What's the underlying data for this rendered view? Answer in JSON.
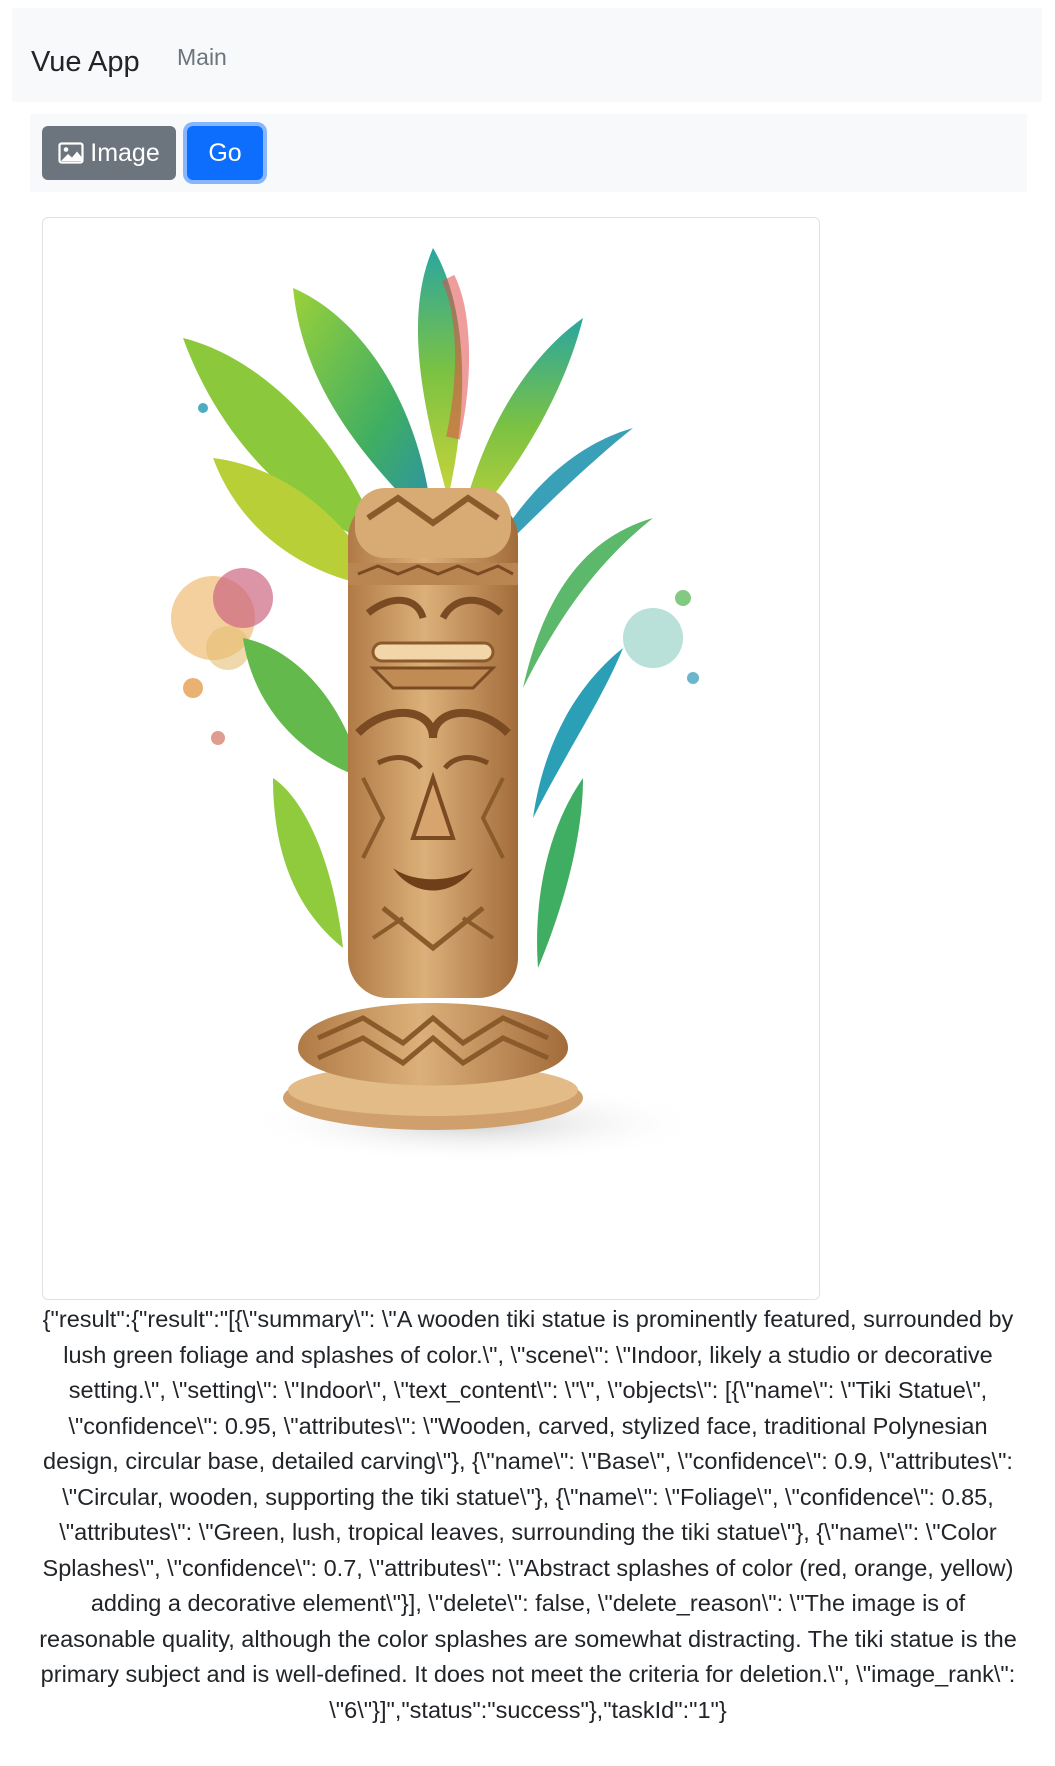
{
  "navbar": {
    "brand": "Vue App",
    "links": [
      {
        "label": "Main"
      }
    ]
  },
  "toolbar": {
    "image_button_label": "Image",
    "image_button_icon": "image-icon",
    "go_button_label": "Go"
  },
  "image": {
    "subject": "watercolor-illustration"
  },
  "result_text": "{\"result\":{\"result\":\"[{\\\"summary\\\": \\\"A wooden tiki statue is prominently featured, surrounded by lush green foliage and splashes of color.\\\", \\\"scene\\\": \\\"Indoor, likely a studio or decorative setting.\\\", \\\"setting\\\": \\\"Indoor\\\", \\\"text_content\\\": \\\"\\\", \\\"objects\\\": [{\\\"name\\\": \\\"Tiki Statue\\\", \\\"confidence\\\": 0.95, \\\"attributes\\\": \\\"Wooden, carved, stylized face, traditional Polynesian design, circular base, detailed carving\\\"}, {\\\"name\\\": \\\"Base\\\", \\\"confidence\\\": 0.9, \\\"attributes\\\": \\\"Circular, wooden, supporting the tiki statue\\\"}, {\\\"name\\\": \\\"Foliage\\\", \\\"confidence\\\": 0.85, \\\"attributes\\\": \\\"Green, lush, tropical leaves, surrounding the tiki statue\\\"}, {\\\"name\\\": \\\"Color Splashes\\\", \\\"confidence\\\": 0.7, \\\"attributes\\\": \\\"Abstract splashes of color (red, orange, yellow) adding a decorative element\\\"}], \\\"delete\\\": false, \\\"delete_reason\\\": \\\"The image is of reasonable quality, although the color splashes are somewhat distracting. The tiki statue is the primary subject and is well-defined. It does not meet the criteria for deletion.\\\", \\\"image_rank\\\": \\\"6\\\"}]\",\"status\":\"success\"},\"taskId\":\"1\"}",
  "colors": {
    "primary": "#0d6efd",
    "secondary": "#6c757d",
    "navbar_bg": "#f8f9fa"
  }
}
